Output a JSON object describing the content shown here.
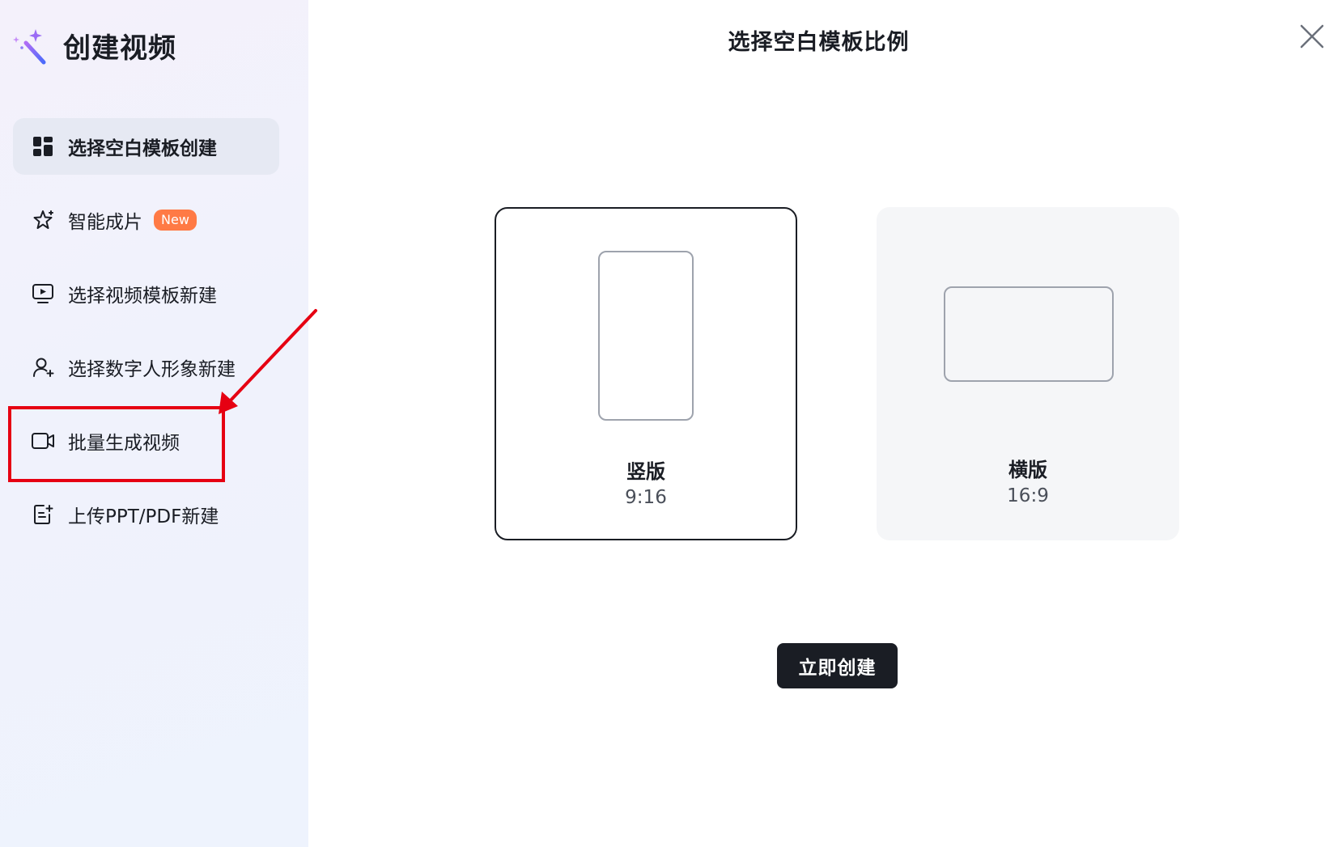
{
  "sidebar": {
    "title": "创建视频",
    "brand_icon": "magic-wand-icon",
    "items": [
      {
        "label": "选择空白模板创建",
        "icon": "grid-layout-icon",
        "active": true
      },
      {
        "label": "智能成片",
        "icon": "sparkle-star-icon",
        "badge": "New"
      },
      {
        "label": "选择视频模板新建",
        "icon": "video-play-icon"
      },
      {
        "label": "选择数字人形象新建",
        "icon": "avatar-person-icon"
      },
      {
        "label": "批量生成视频",
        "icon": "video-camera-icon"
      },
      {
        "label": "上传PPT/PDF新建",
        "icon": "document-upload-icon"
      }
    ]
  },
  "main": {
    "title": "选择空白模板比例",
    "close_icon": "close-icon",
    "options": [
      {
        "name": "竖版",
        "ratio": "9:16",
        "selected": true
      },
      {
        "name": "横版",
        "ratio": "16:9",
        "selected": false
      }
    ],
    "create_label": "立即创建"
  },
  "colors": {
    "accent_dark": "#1a1d24",
    "badge": "#ff7a45",
    "annotation_red": "#e60012"
  }
}
